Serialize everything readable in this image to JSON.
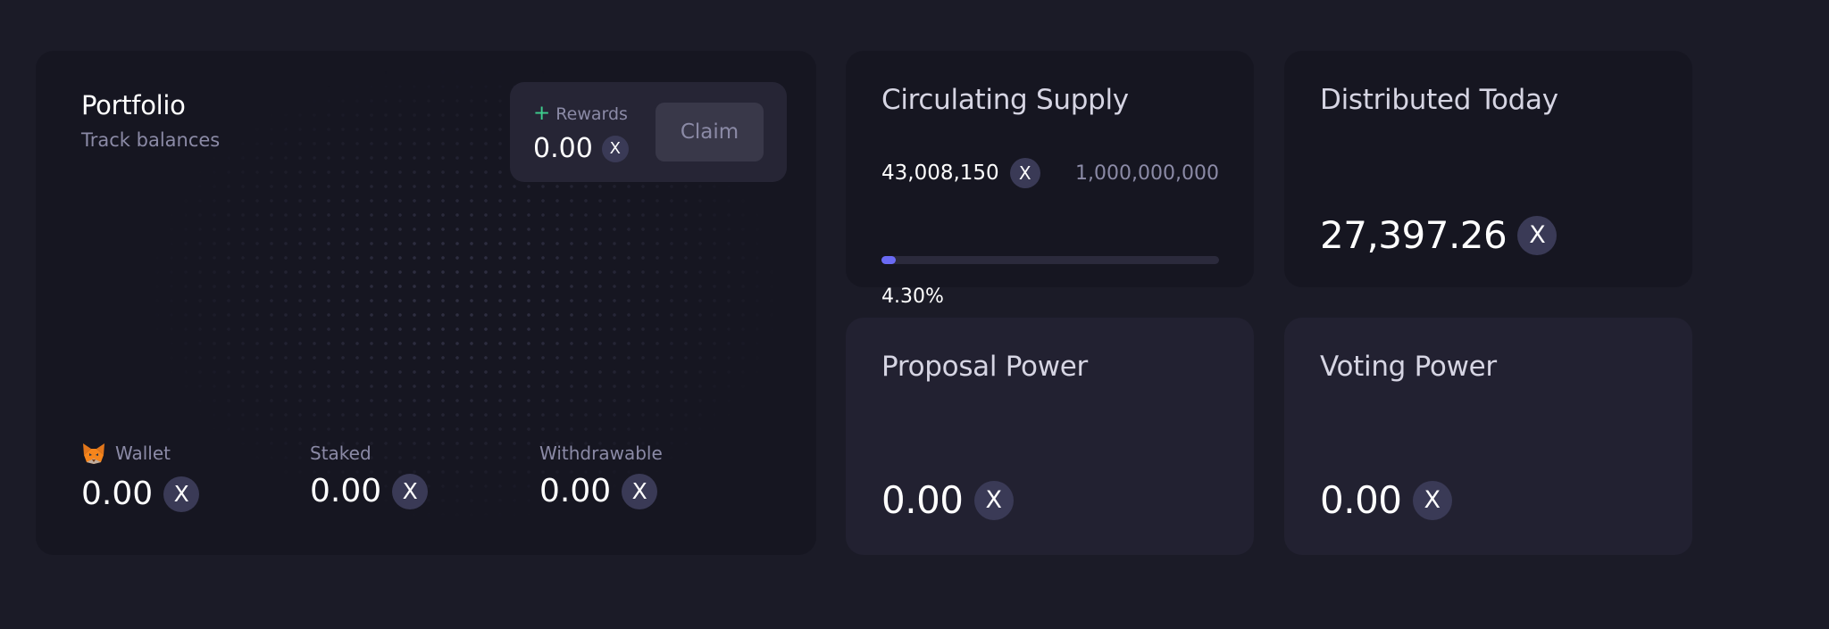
{
  "portfolio": {
    "title": "Portfolio",
    "subtitle": "Track balances",
    "rewards": {
      "plus": "+",
      "label": "Rewards",
      "value": "0.00",
      "claim_label": "Claim"
    },
    "balances": [
      {
        "label": "Wallet",
        "value": "0.00",
        "icon": "metamask-fox-icon"
      },
      {
        "label": "Staked",
        "value": "0.00"
      },
      {
        "label": "Withdrawable",
        "value": "0.00"
      }
    ]
  },
  "token_icon": {
    "name": "x-token-icon",
    "glyph": "X"
  },
  "circulating_supply": {
    "title": "Circulating Supply",
    "current": "43,008,150",
    "max": "1,000,000,000",
    "percent_text": "4.30%",
    "percent_value": 4.3
  },
  "distributed_today": {
    "title": "Distributed Today",
    "value": "27,397.26"
  },
  "proposal_power": {
    "title": "Proposal Power",
    "value": "0.00"
  },
  "voting_power": {
    "title": "Voting Power",
    "value": "0.00"
  },
  "colors": {
    "background": "#1b1b27",
    "card": "#161621",
    "card_alt": "#222131",
    "accent": "#6a6af4",
    "positive": "#3ecf8e",
    "muted_text": "#8b8aa6"
  }
}
